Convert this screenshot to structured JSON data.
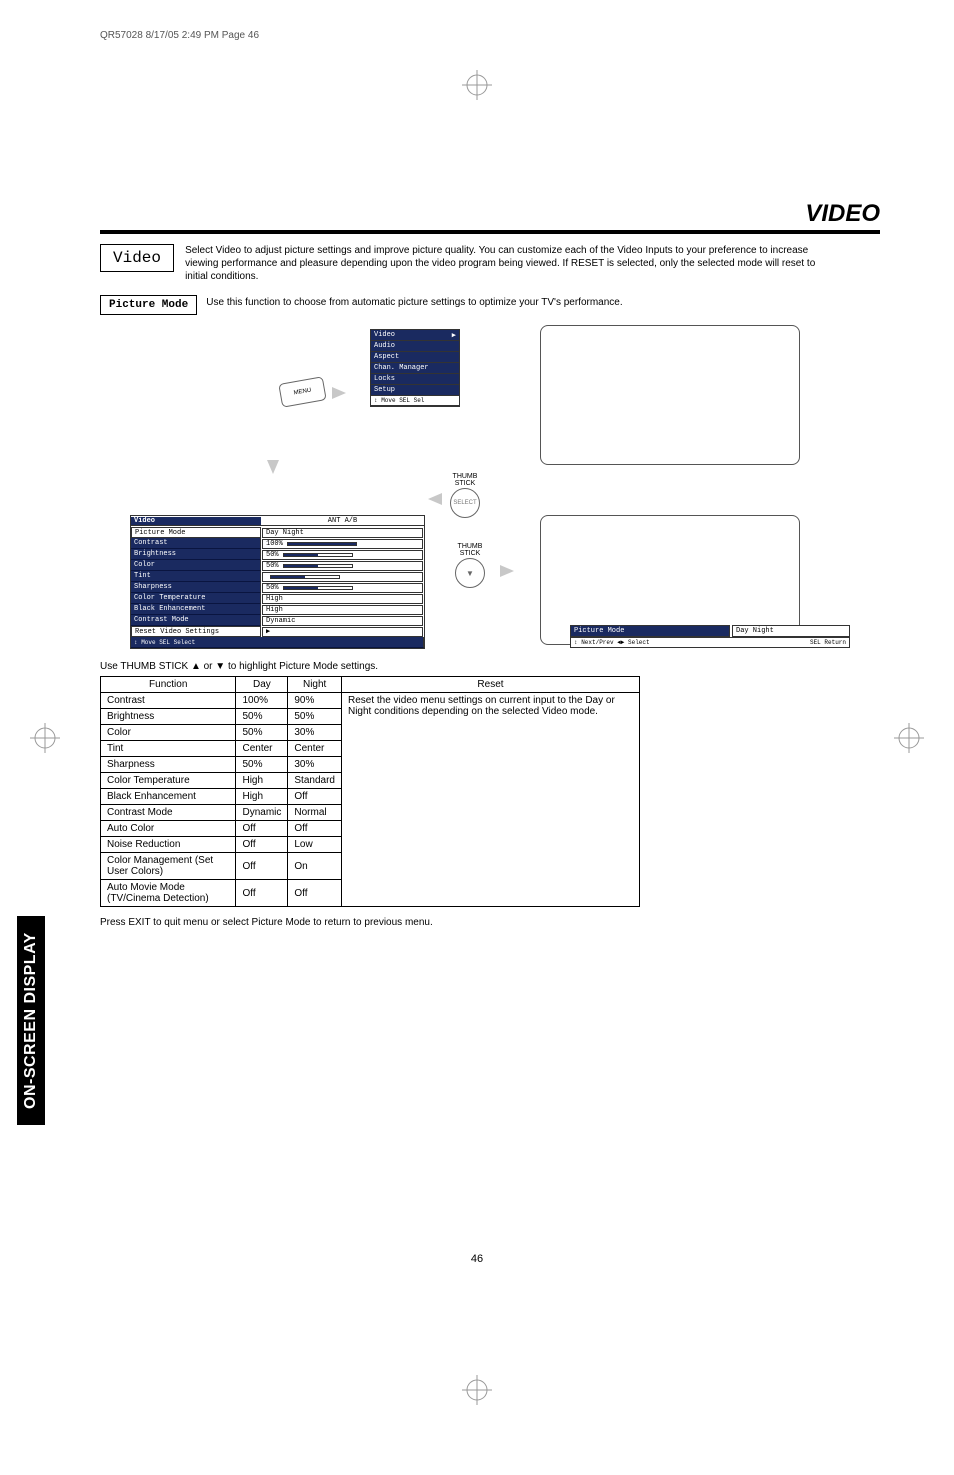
{
  "meta": {
    "page_ref": "QR57028  8/17/05  2:49 PM  Page 46",
    "page_number": "46"
  },
  "sidebar": "ON-SCREEN DISPLAY",
  "title": "VIDEO",
  "video_box_label": "Video",
  "intro": "Select Video to adjust picture settings and improve picture quality.  You can customize each of the Video Inputs to your preference to increase viewing performance and pleasure depending upon the video program being viewed.  If RESET is selected, only the selected mode will reset to initial conditions.",
  "picture_mode_label": "Picture Mode",
  "picture_mode_desc": "Use this function to choose from automatic picture settings to optimize your TV's performance.",
  "osd_main": {
    "items": [
      "Video",
      "Audio",
      "Aspect",
      "Chan. Manager",
      "Locks",
      "Setup"
    ],
    "footer": "↕ Move  SEL Sel"
  },
  "osd_settings": {
    "header_left": "Video",
    "header_right": "ANT A/B",
    "rows": [
      {
        "label": "Picture Mode",
        "value": "Day      Night",
        "type": "text",
        "hl": true
      },
      {
        "label": "Contrast",
        "value": "100%",
        "type": "bar",
        "pct": 100
      },
      {
        "label": "Brightness",
        "value": "50%",
        "type": "bar",
        "pct": 50
      },
      {
        "label": "Color",
        "value": "50%",
        "type": "bar",
        "pct": 50
      },
      {
        "label": "Tint",
        "value": "",
        "type": "bar",
        "pct": 50
      },
      {
        "label": "Sharpness",
        "value": "50%",
        "type": "bar",
        "pct": 50
      },
      {
        "label": "Color Temperature",
        "value": "High",
        "type": "text"
      },
      {
        "label": "Black Enhancement",
        "value": "High",
        "type": "text"
      },
      {
        "label": "Contrast Mode",
        "value": "Dynamic",
        "type": "text"
      },
      {
        "label": "Reset Video Settings",
        "value": "▶",
        "type": "arrow",
        "hl": true
      }
    ],
    "footer": "↕ Move  SEL Select"
  },
  "osd_strip": {
    "left": "Picture Mode",
    "right": "Day  Night",
    "footer_left": "↕ Next/Prev  ◄► Select",
    "footer_right": "SEL Return"
  },
  "thumb_stick_label": "THUMB\nSTICK",
  "remote_label": "MENU",
  "instruction_highlight": "Use THUMB STICK ▲ or ▼ to highlight Picture Mode settings.",
  "table": {
    "headers": [
      "Function",
      "Day",
      "Night",
      "Reset"
    ],
    "rows": [
      [
        "Contrast",
        "100%",
        "90%"
      ],
      [
        "Brightness",
        "50%",
        "50%"
      ],
      [
        "Color",
        "50%",
        "30%"
      ],
      [
        "Tint",
        "Center",
        "Center"
      ],
      [
        "Sharpness",
        "50%",
        "30%"
      ],
      [
        "Color Temperature",
        "High",
        "Standard"
      ],
      [
        "Black Enhancement",
        "High",
        "Off"
      ],
      [
        "Contrast Mode",
        "Dynamic",
        "Normal"
      ],
      [
        "Auto Color",
        "Off",
        "Off"
      ],
      [
        "Noise Reduction",
        "Off",
        "Low"
      ],
      [
        "Color Management (Set User Colors)",
        "Off",
        "On"
      ],
      [
        "Auto Movie Mode (TV/Cinema Detection)",
        "Off",
        "Off"
      ]
    ],
    "reset_text": "Reset the video menu settings on current input to the Day or Night conditions depending on the selected Video mode."
  },
  "exit_instruction": "Press EXIT to quit menu or select Picture Mode to return to previous menu."
}
